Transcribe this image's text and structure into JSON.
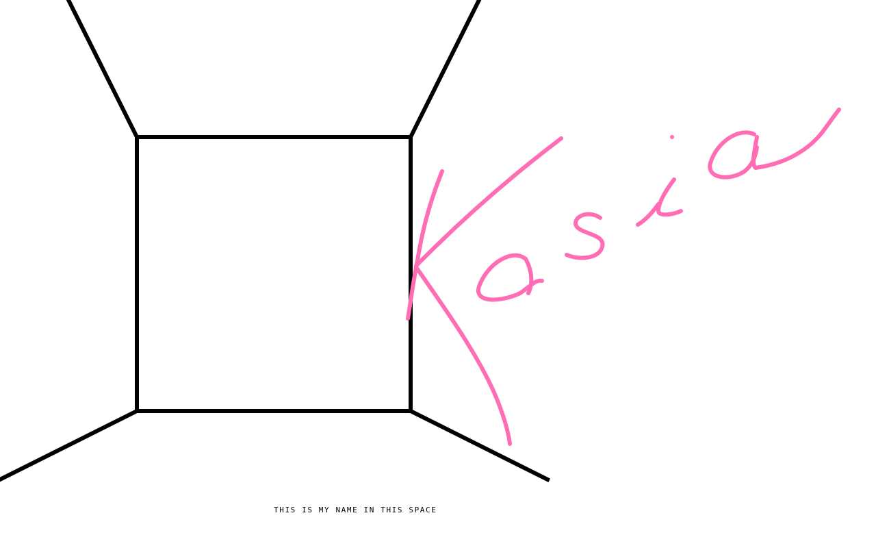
{
  "canvas": {
    "background": "#ffffff",
    "line_color": "#000000",
    "signature_color": "#ff6eb4"
  },
  "signature": {
    "text": "Kasia",
    "kind": "handwritten signature drawn as strokes"
  },
  "caption": {
    "text": "THIS IS MY NAME IN THIS SPACE"
  }
}
